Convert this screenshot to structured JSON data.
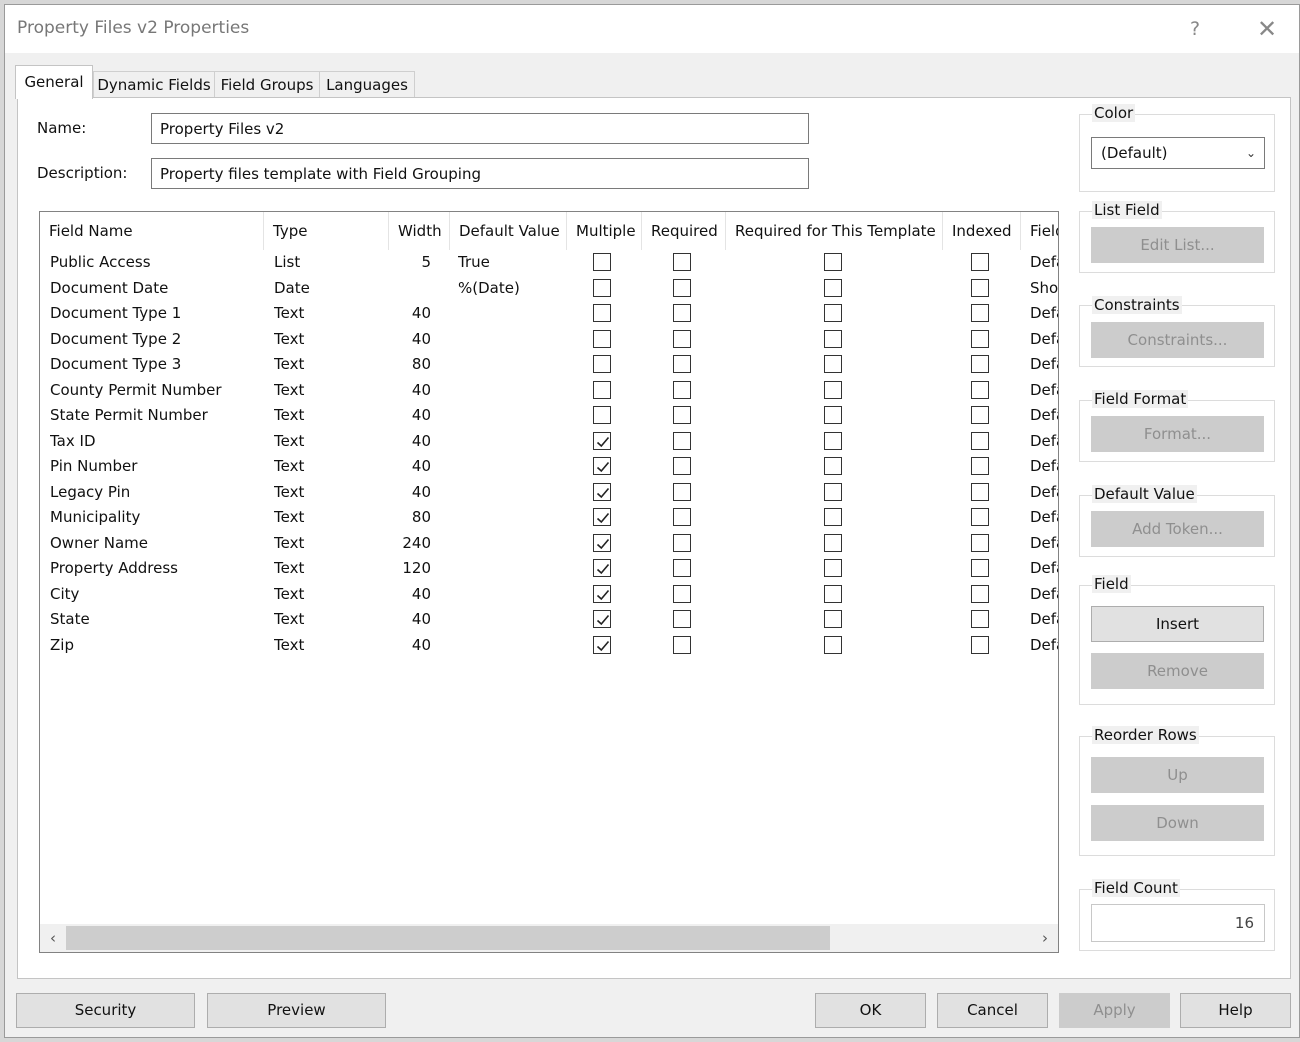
{
  "window": {
    "title": "Property Files v2 Properties",
    "help_glyph": "?",
    "close_glyph": "✕"
  },
  "tabs": [
    {
      "label": "General",
      "active": true
    },
    {
      "label": "Dynamic Fields",
      "active": false
    },
    {
      "label": "Field Groups",
      "active": false
    },
    {
      "label": "Languages",
      "active": false
    }
  ],
  "general": {
    "name_label": "Name:",
    "name_value": "Property Files v2",
    "description_label": "Description:",
    "description_value": "Property files template with Field Grouping"
  },
  "table": {
    "columns": [
      "Field Name",
      "Type",
      "Width",
      "Default Value",
      "Multiple",
      "Required",
      "Required for This Template",
      "Indexed",
      "Field"
    ],
    "rows": [
      {
        "name": "Public Access",
        "type": "List",
        "width": "5",
        "default": "True",
        "multiple": false,
        "required": false,
        "req_template": false,
        "indexed": false,
        "field_format": "Default"
      },
      {
        "name": "Document Date",
        "type": "Date",
        "width": "",
        "default": "%(Date)",
        "multiple": false,
        "required": false,
        "req_template": false,
        "indexed": false,
        "field_format": "Short"
      },
      {
        "name": "Document Type 1",
        "type": "Text",
        "width": "40",
        "default": "",
        "multiple": false,
        "required": false,
        "req_template": false,
        "indexed": false,
        "field_format": "Default"
      },
      {
        "name": "Document Type 2",
        "type": "Text",
        "width": "40",
        "default": "",
        "multiple": false,
        "required": false,
        "req_template": false,
        "indexed": false,
        "field_format": "Default"
      },
      {
        "name": "Document Type 3",
        "type": "Text",
        "width": "80",
        "default": "",
        "multiple": false,
        "required": false,
        "req_template": false,
        "indexed": false,
        "field_format": "Default"
      },
      {
        "name": "County Permit Number",
        "type": "Text",
        "width": "40",
        "default": "",
        "multiple": false,
        "required": false,
        "req_template": false,
        "indexed": false,
        "field_format": "Default"
      },
      {
        "name": "State Permit Number",
        "type": "Text",
        "width": "40",
        "default": "",
        "multiple": false,
        "required": false,
        "req_template": false,
        "indexed": false,
        "field_format": "Default"
      },
      {
        "name": "Tax ID",
        "type": "Text",
        "width": "40",
        "default": "",
        "multiple": true,
        "required": false,
        "req_template": false,
        "indexed": false,
        "field_format": "Default"
      },
      {
        "name": "Pin Number",
        "type": "Text",
        "width": "40",
        "default": "",
        "multiple": true,
        "required": false,
        "req_template": false,
        "indexed": false,
        "field_format": "Default"
      },
      {
        "name": "Legacy Pin",
        "type": "Text",
        "width": "40",
        "default": "",
        "multiple": true,
        "required": false,
        "req_template": false,
        "indexed": false,
        "field_format": "Default"
      },
      {
        "name": "Municipality",
        "type": "Text",
        "width": "80",
        "default": "",
        "multiple": true,
        "required": false,
        "req_template": false,
        "indexed": false,
        "field_format": "Default"
      },
      {
        "name": "Owner Name",
        "type": "Text",
        "width": "240",
        "default": "",
        "multiple": true,
        "required": false,
        "req_template": false,
        "indexed": false,
        "field_format": "Default"
      },
      {
        "name": "Property Address",
        "type": "Text",
        "width": "120",
        "default": "",
        "multiple": true,
        "required": false,
        "req_template": false,
        "indexed": false,
        "field_format": "Default"
      },
      {
        "name": "City",
        "type": "Text",
        "width": "40",
        "default": "",
        "multiple": true,
        "required": false,
        "req_template": false,
        "indexed": false,
        "field_format": "Default"
      },
      {
        "name": "State",
        "type": "Text",
        "width": "40",
        "default": "",
        "multiple": true,
        "required": false,
        "req_template": false,
        "indexed": false,
        "field_format": "Default"
      },
      {
        "name": "Zip",
        "type": "Text",
        "width": "40",
        "default": "",
        "multiple": true,
        "required": false,
        "req_template": false,
        "indexed": false,
        "field_format": "Default"
      }
    ],
    "scroll_left": "‹",
    "scroll_right": "›"
  },
  "side": {
    "color": {
      "title": "Color",
      "value": "(Default)"
    },
    "list_field": {
      "title": "List Field",
      "button": "Edit List..."
    },
    "constraints": {
      "title": "Constraints",
      "button": "Constraints..."
    },
    "field_format": {
      "title": "Field Format",
      "button": "Format..."
    },
    "default_value": {
      "title": "Default Value",
      "button": "Add Token..."
    },
    "field": {
      "title": "Field",
      "insert": "Insert",
      "remove": "Remove"
    },
    "reorder": {
      "title": "Reorder Rows",
      "up": "Up",
      "down": "Down"
    },
    "field_count": {
      "title": "Field Count",
      "value": "16"
    }
  },
  "footer": {
    "security": "Security",
    "preview": "Preview",
    "ok": "OK",
    "cancel": "Cancel",
    "apply": "Apply",
    "help": "Help"
  }
}
